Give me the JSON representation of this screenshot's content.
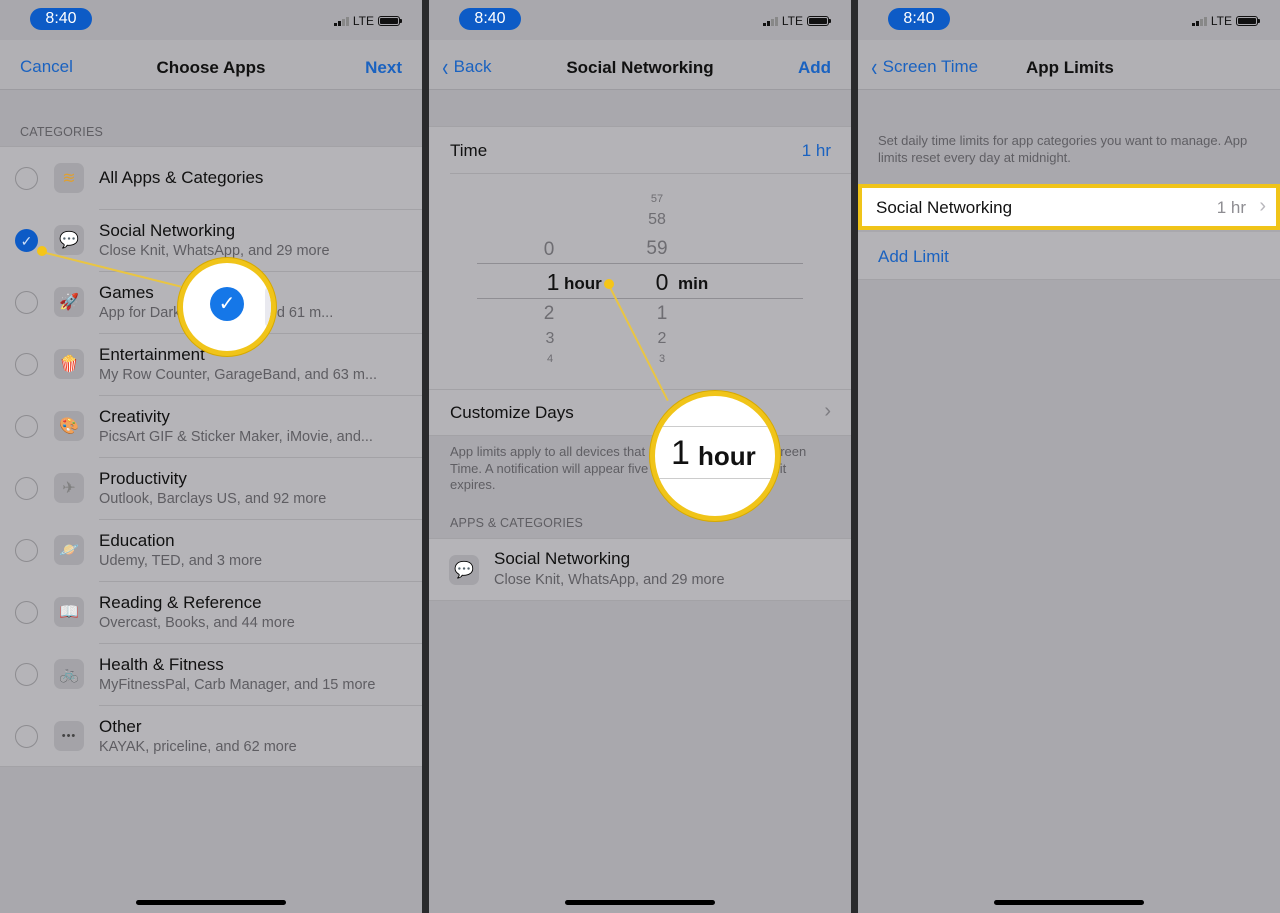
{
  "status_bar": {
    "time": "8:40",
    "network": "LTE",
    "signal_bars": 2,
    "signal_bars_total": 4
  },
  "panel1": {
    "nav": {
      "left": "Cancel",
      "title": "Choose Apps",
      "right": "Next"
    },
    "section_header": "CATEGORIES",
    "items": [
      {
        "title": "All Apps & Categories",
        "subtitle": "",
        "icon": "stack-icon",
        "glyph": "≋",
        "color": "#e0a030",
        "checked": false
      },
      {
        "title": "Social Networking",
        "subtitle": "Close Knit, WhatsApp, and 29 more",
        "icon": "chat-bubbles-icon",
        "glyph": "💬",
        "color": "#d6336c",
        "checked": true
      },
      {
        "title": "Games",
        "subtitle": "App for Dark Sky, Roller, and 61 m...",
        "icon": "rocket-icon",
        "glyph": "🚀",
        "color": "#3a8fd6",
        "checked": false
      },
      {
        "title": "Entertainment",
        "subtitle": "My Row Counter, GarageBand, and 63 m...",
        "icon": "popcorn-icon",
        "glyph": "🍿",
        "color": "#d03030",
        "checked": false
      },
      {
        "title": "Creativity",
        "subtitle": "PicsArt GIF & Sticker Maker, iMovie, and...",
        "icon": "palette-icon",
        "glyph": "🎨",
        "color": "#e6a800",
        "checked": false
      },
      {
        "title": "Productivity",
        "subtitle": "Outlook, Barclays US, and 92 more",
        "icon": "paper-plane-icon",
        "glyph": "✈",
        "color": "#808080",
        "checked": false
      },
      {
        "title": "Education",
        "subtitle": "Udemy, TED, and 3 more",
        "icon": "planet-icon",
        "glyph": "🪐",
        "color": "#e26a2c",
        "checked": false
      },
      {
        "title": "Reading & Reference",
        "subtitle": "Overcast, Books, and 44 more",
        "icon": "book-icon",
        "glyph": "📖",
        "color": "#2d7fb8",
        "checked": false
      },
      {
        "title": "Health & Fitness",
        "subtitle": "MyFitnessPal, Carb Manager, and 15 more",
        "icon": "bicycle-icon",
        "glyph": "🚲",
        "color": "#2d7fb8",
        "checked": false
      },
      {
        "title": "Other",
        "subtitle": "KAYAK, priceline, and 62 more",
        "icon": "more-dots-icon",
        "glyph": "•••",
        "color": "#444444",
        "checked": false
      }
    ],
    "callout_glyph": "✓"
  },
  "panel2": {
    "nav": {
      "back": "Back",
      "title": "Social Networking",
      "right": "Add"
    },
    "time_label": "Time",
    "time_value": "1 hr",
    "picker": {
      "hours_above": [
        "0"
      ],
      "hours_selected": "1",
      "hours_unit": "hour",
      "hours_below": [
        "2",
        "3",
        "4"
      ],
      "mins_above": [
        "57",
        "58",
        "59"
      ],
      "mins_selected": "0",
      "mins_unit": "min",
      "mins_below": [
        "1",
        "2",
        "3"
      ]
    },
    "customize_label": "Customize Days",
    "footnote": "App limits apply to all devices that are using iCloud for Screen Time. A notification will appear five minutes before the limit expires.",
    "section_header": "APPS & CATEGORIES",
    "selected_item": {
      "title": "Social Networking",
      "subtitle": "Close Knit, WhatsApp, and 29 more",
      "glyph": "💬"
    },
    "callout": {
      "number": "1",
      "unit": "hour"
    }
  },
  "panel3": {
    "nav": {
      "back": "Screen Time",
      "title": "App Limits"
    },
    "description": "Set daily time limits for app categories you want to manage. App limits reset every day at midnight.",
    "limit_row": {
      "label": "Social Networking",
      "value": "1 hr"
    },
    "add_limit": "Add Limit"
  }
}
